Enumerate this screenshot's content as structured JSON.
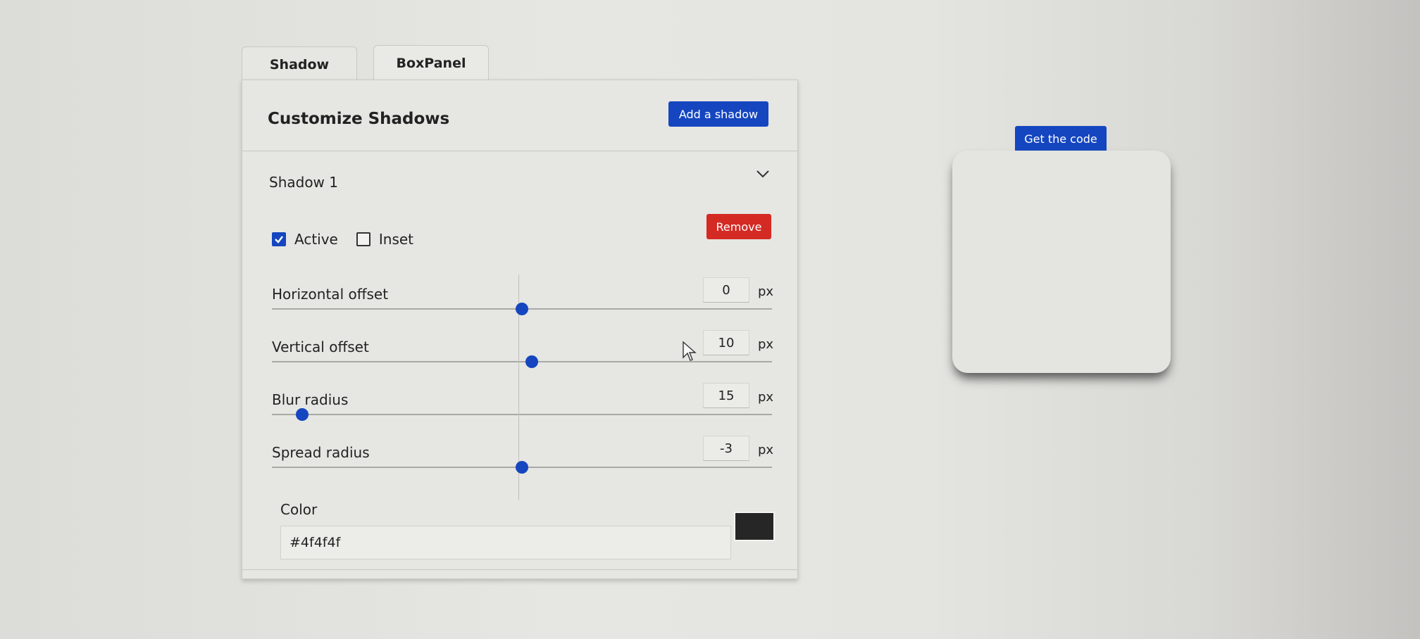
{
  "tabs": [
    {
      "label": "Shadow"
    },
    {
      "label": "BoxPanel"
    }
  ],
  "panel": {
    "title": "Customize Shadows",
    "add_button": "Add a shadow"
  },
  "shadow": {
    "title": "Shadow 1",
    "expanded_icon": "chevron-down-icon",
    "active_label": "Active",
    "active_checked": true,
    "inset_label": "Inset",
    "inset_checked": false,
    "remove_button": "Remove",
    "sliders": [
      {
        "label": "Horizontal offset",
        "value": "0",
        "unit": "px",
        "fraction": 0.5
      },
      {
        "label": "Vertical offset",
        "value": "10",
        "unit": "px",
        "fraction": 0.52
      },
      {
        "label": "Blur radius",
        "value": "15",
        "unit": "px",
        "fraction": 0.06
      },
      {
        "label": "Spread radius",
        "value": "-3",
        "unit": "px",
        "fraction": 0.5
      }
    ],
    "color_label": "Color",
    "color_value": "#4f4f4f",
    "swatch_color": "#262626"
  },
  "preview": {
    "code_button": "Get the code"
  },
  "colors": {
    "primary": "#1546c0",
    "danger": "#d42a24"
  }
}
